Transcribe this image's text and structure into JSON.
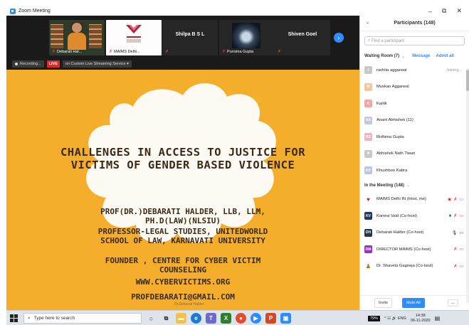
{
  "window": {
    "title": "Zoom Meeting",
    "minimize_glyph": "–",
    "restore_glyph": "⧉",
    "close_glyph": "✕"
  },
  "video_strip": {
    "tiles": [
      {
        "name": "Debarati Hal..."
      },
      {
        "name": "MAIMS Delhi..."
      },
      {
        "center_name": "Shilpa B S L"
      },
      {
        "name": "Purnima Gupta"
      },
      {
        "center_name": "Shiven Goel"
      }
    ],
    "next_glyph": "›"
  },
  "status_bar": {
    "recording": "Recording...",
    "live": "LIVE",
    "streaming": "on Custom Live Streaming Service"
  },
  "slide": {
    "title_line1": "CHALLENGES IN ACCESS TO JUSTICE FOR",
    "title_line2": "VICTIMS OF GENDER BASED VIOLENCE",
    "author_line1": "PROF(DR.)DEBARATI HALDER, LLB, LLM,",
    "author_line2": "PH.D(LAW)(NLSIU)",
    "role_line1": "PROFESSOR-LEGAL STUDIES, UNITEDWORLD",
    "role_line2": "SCHOOL OF LAW, KARNAVATI UNIVERSITY",
    "founder_line1": "FOUNDER , CENTRE FOR CYBER VICTIM",
    "founder_line2": "COUNSELING",
    "website": "WWW.CYBERVICTIMS.ORG",
    "email": "PROFDEBARATI@GMAIL.COM",
    "watermark": "Dr.Debarati Halder",
    "colors": {
      "background": "#f5ae2b",
      "blob": "#fdfaf3",
      "text": "#3a2a1a"
    }
  },
  "participants": {
    "header": "Participants (148)",
    "search_placeholder": "Find a participant",
    "waiting_room_label": "Waiting Room (7)",
    "message_label": "Message",
    "admit_all_label": "Admit all",
    "waiting": [
      {
        "initial": "r",
        "name": "rachita aggarwal",
        "status": "Joining...",
        "color": "#c9c9c9"
      },
      {
        "initial": "M",
        "name": "Muskan Aggarwal",
        "status": "",
        "color": "#f2c79b"
      },
      {
        "initial": "K",
        "name": "Kartik",
        "status": "",
        "color": "#f2a7a7"
      },
      {
        "initial": "AA",
        "name": "Anant Abhishek (11)",
        "status": "",
        "color": "#c4c9d6"
      },
      {
        "initial": "RG",
        "name": "Ridhima Gupta",
        "status": "",
        "color": "#f0b3c4"
      },
      {
        "initial": "A",
        "name": "Abhishek Nath Tiwari",
        "status": "",
        "color": "#c9c9c9"
      },
      {
        "initial": "KK",
        "name": "Khushboo Kabra",
        "status": "",
        "color": "#b9c6e6"
      }
    ],
    "in_meeting_label": "In the Meeting (148)",
    "in_meeting": [
      {
        "initial": "♥",
        "name": "MAIMS Delhi IN (Host, me)",
        "color": "#ffffff"
      },
      {
        "initial": "KV",
        "name": "Kamna Vaid (Co-host)",
        "color": "#1f3b5a"
      },
      {
        "initial": "DH",
        "name": "Debarati Halder (Co-host)",
        "color": "#26364a"
      },
      {
        "initial": "DM",
        "name": "DIRECTOR MAIMS (Co-host)",
        "color": "#9b2fc9"
      },
      {
        "initial": "♟",
        "name": "Dr. Shaveta Gagneja (Co-host)",
        "color": "#ffffff"
      }
    ],
    "invite_label": "Invite",
    "mute_all_label": "Mute All",
    "more_label": "..."
  },
  "taskbar": {
    "search_placeholder": "Type here to search",
    "battery": "79%",
    "tray_icons": "^ ☷ 🔊 ENG",
    "time": "14:38",
    "date": "06-11-2020"
  }
}
